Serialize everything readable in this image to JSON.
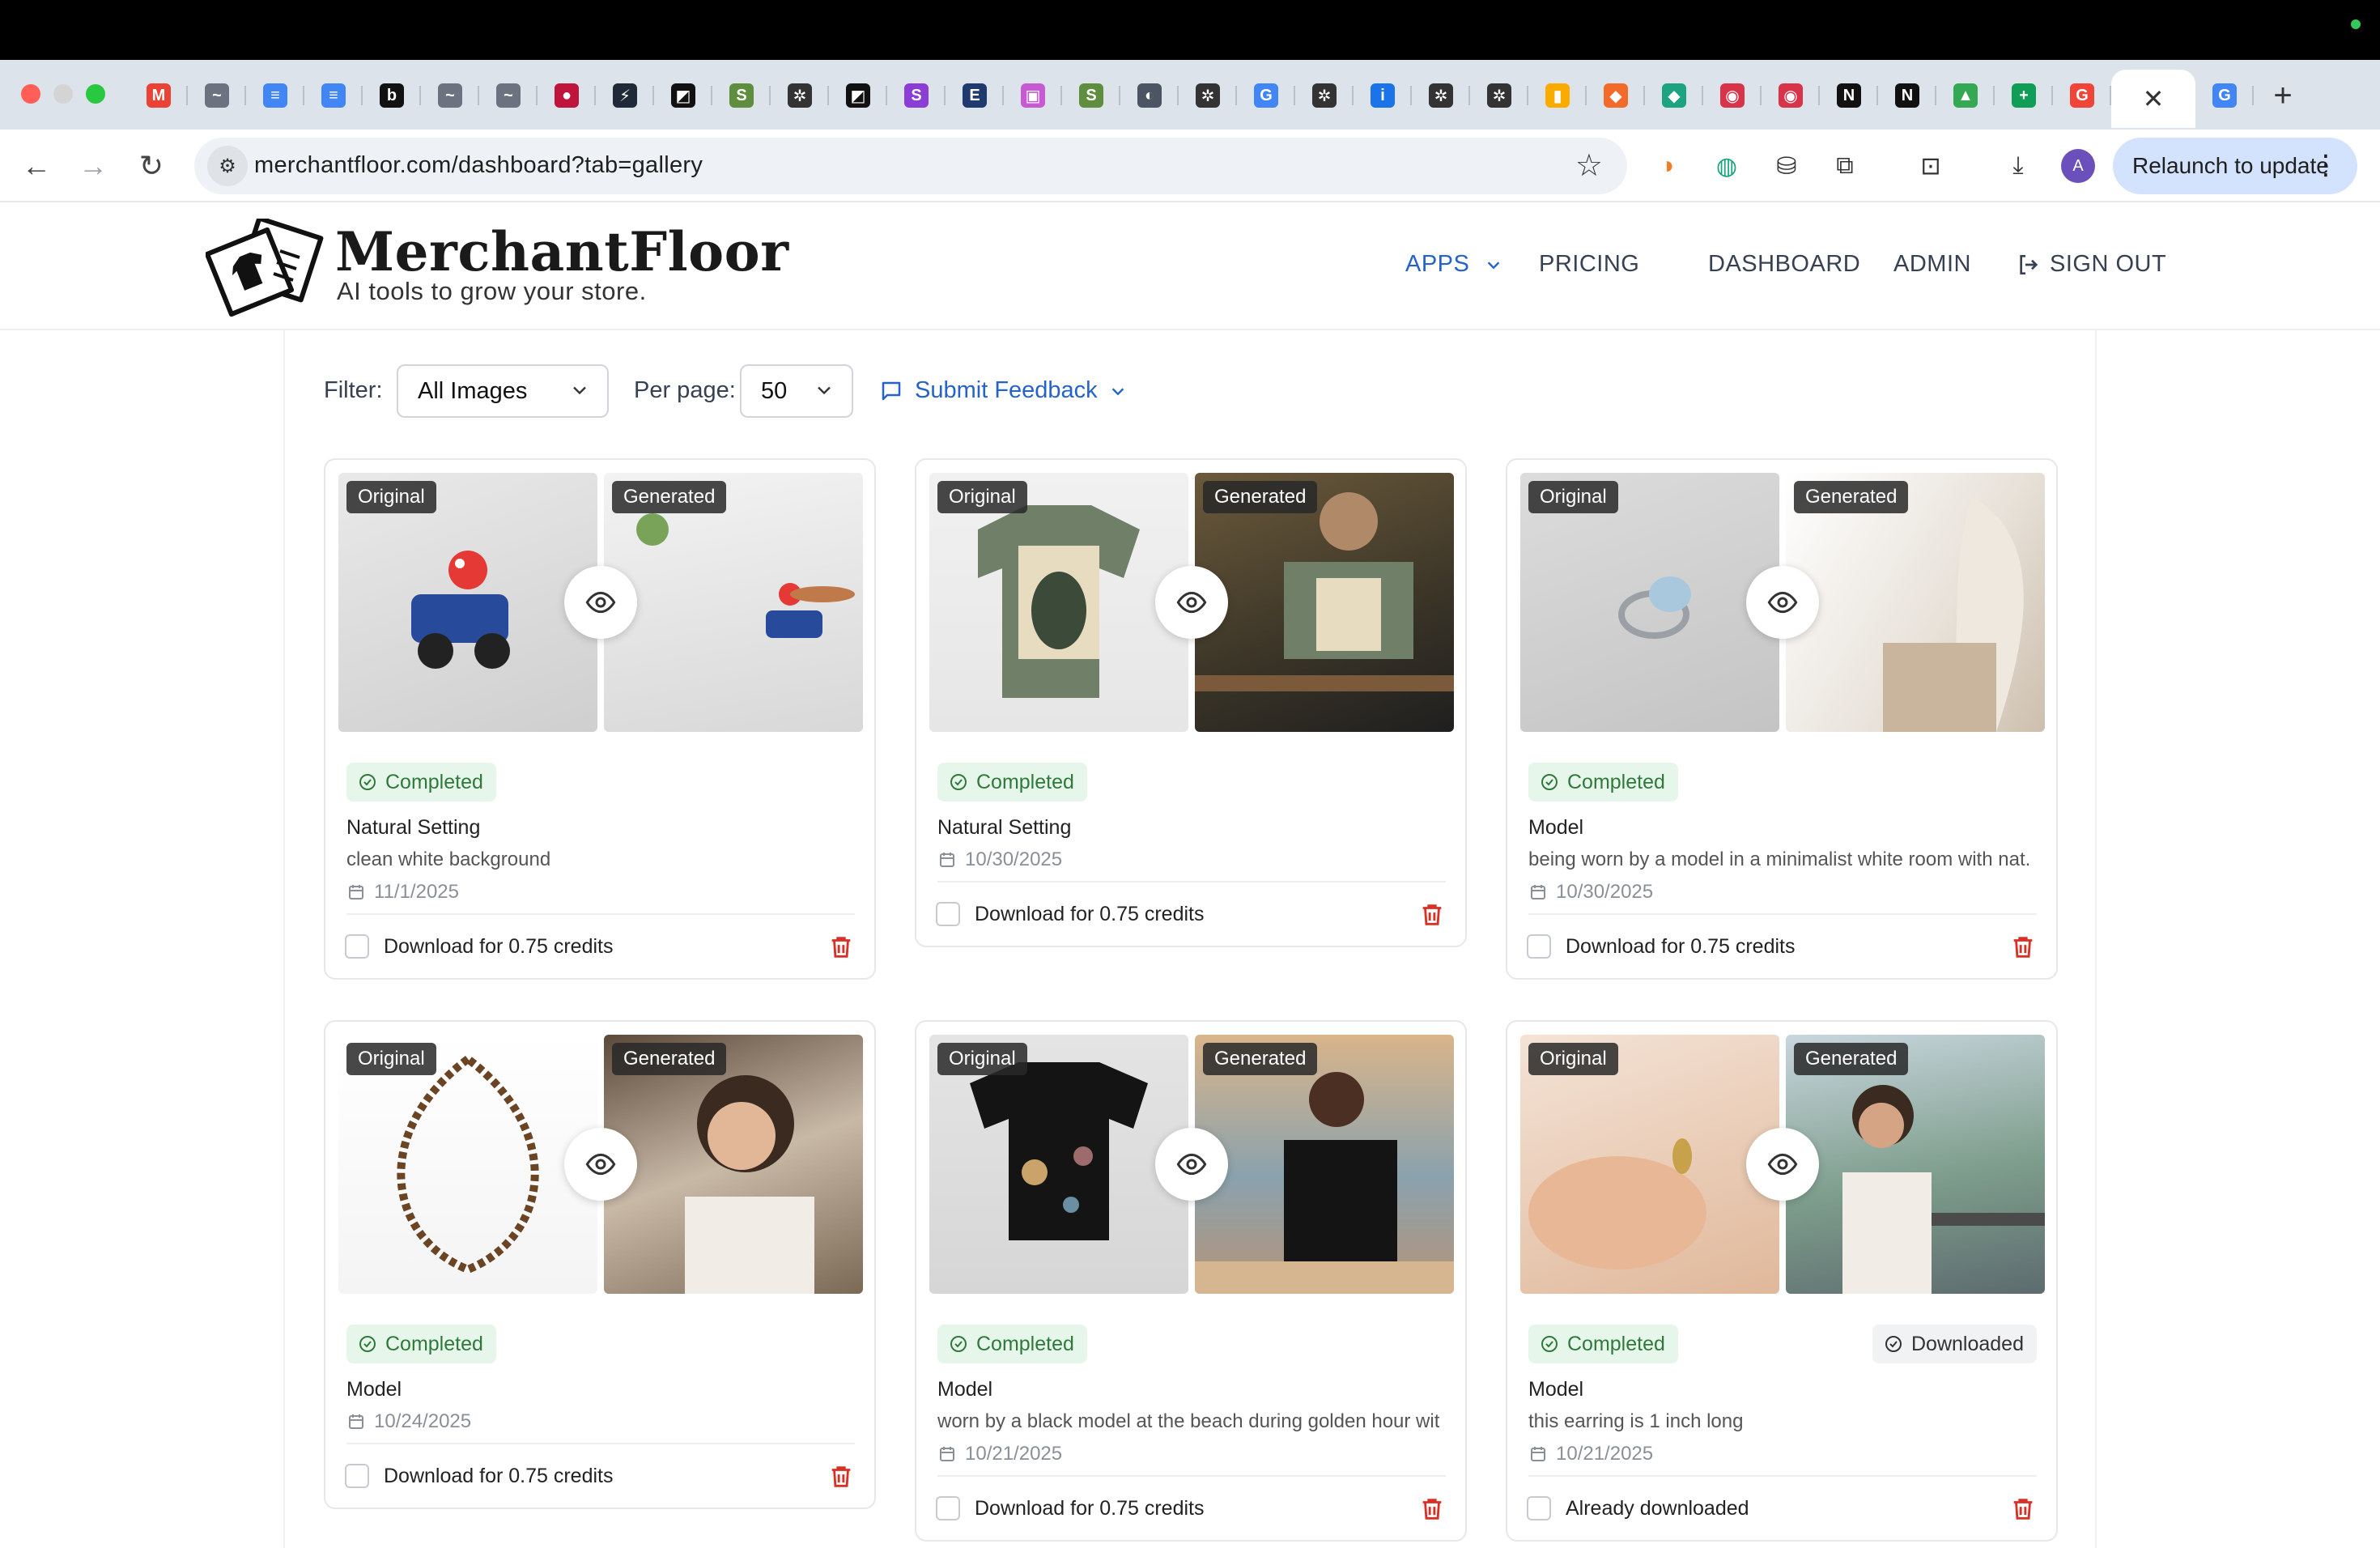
{
  "browser": {
    "url": "merchantfloor.com/dashboard?tab=gallery",
    "relaunch_label": "Relaunch to update",
    "profile_initial": "A",
    "active_tab_close": "✕",
    "new_tab": "+",
    "tab_favicons": [
      {
        "icon": "gmail-icon",
        "glyph": "M",
        "color": "#ea4335"
      },
      {
        "icon": "bird-icon",
        "glyph": "~",
        "color": "#6b7280"
      },
      {
        "icon": "docs-icon",
        "glyph": "≡",
        "color": "#4285f4"
      },
      {
        "icon": "docs-icon",
        "glyph": "≡",
        "color": "#4285f4"
      },
      {
        "icon": "b-icon",
        "glyph": "b",
        "color": "#111111"
      },
      {
        "icon": "bird-icon",
        "glyph": "~",
        "color": "#6b7280"
      },
      {
        "icon": "bird-icon",
        "glyph": "~",
        "color": "#6b7280"
      },
      {
        "icon": "lg-icon",
        "glyph": "●",
        "color": "#c0143c"
      },
      {
        "icon": "bolt-icon",
        "glyph": "⚡",
        "color": "#1f2937"
      },
      {
        "icon": "slash-icon",
        "glyph": "◩",
        "color": "#111111"
      },
      {
        "icon": "shopify-icon",
        "glyph": "S",
        "color": "#5e8e3e"
      },
      {
        "icon": "openai-icon",
        "glyph": "✲",
        "color": "#333333"
      },
      {
        "icon": "slash-icon",
        "glyph": "◩",
        "color": "#111111"
      },
      {
        "icon": "s-icon",
        "glyph": "S",
        "color": "#8b3dd6"
      },
      {
        "icon": "elf-icon",
        "glyph": "E",
        "color": "#1e3a6e"
      },
      {
        "icon": "image-icon",
        "glyph": "▣",
        "color": "#c65ad2"
      },
      {
        "icon": "shopify-icon",
        "glyph": "S",
        "color": "#5e8e3e"
      },
      {
        "icon": "globe-icon",
        "glyph": "◐",
        "color": "#4b5563"
      },
      {
        "icon": "openai-icon",
        "glyph": "✲",
        "color": "#333333"
      },
      {
        "icon": "google-icon",
        "glyph": "G",
        "color": "#4285f4"
      },
      {
        "icon": "openai-icon",
        "glyph": "✲",
        "color": "#333333"
      },
      {
        "icon": "info-icon",
        "glyph": "i",
        "color": "#1a73e8"
      },
      {
        "icon": "openai-icon",
        "glyph": "✲",
        "color": "#333333"
      },
      {
        "icon": "openai-icon",
        "glyph": "✲",
        "color": "#333333"
      },
      {
        "icon": "analytics-icon",
        "glyph": "▮",
        "color": "#f9ab00"
      },
      {
        "icon": "fox-icon",
        "glyph": "◆",
        "color": "#f26b2a"
      },
      {
        "icon": "diamond-icon",
        "glyph": "◆",
        "color": "#1ea382"
      },
      {
        "icon": "pocket-icon",
        "glyph": "◉",
        "color": "#d9334a"
      },
      {
        "icon": "pocket-icon",
        "glyph": "◉",
        "color": "#d9334a"
      },
      {
        "icon": "notion-icon",
        "glyph": "N",
        "color": "#111111"
      },
      {
        "icon": "notion-icon",
        "glyph": "N",
        "color": "#111111"
      },
      {
        "icon": "drive-icon",
        "glyph": "▲",
        "color": "#34a853"
      },
      {
        "icon": "sheets-icon",
        "glyph": "+",
        "color": "#0f9d58"
      },
      {
        "icon": "grammarly-icon",
        "glyph": "G",
        "color": "#f04438"
      }
    ],
    "last_tab_favicon": {
      "icon": "google-icon",
      "glyph": "G",
      "color": "#4285f4"
    }
  },
  "site": {
    "brand": "MerchantFloor",
    "tagline": "AI tools to grow your store.",
    "nav": {
      "apps": "APPS",
      "pricing": "PRICING",
      "dashboard": "DASHBOARD",
      "admin": "ADMIN",
      "sign_out": "SIGN OUT"
    },
    "accent_color": "#2563c9"
  },
  "controls": {
    "filter_label": "Filter:",
    "filter_value": "All Images",
    "per_page_label": "Per page:",
    "per_page_value": "50",
    "feedback_label": "Submit Feedback"
  },
  "labels": {
    "original": "Original",
    "generated": "Generated",
    "completed": "Completed",
    "downloaded": "Downloaded"
  },
  "cards": [
    {
      "style": "Natural Setting",
      "prompt": "clean white background",
      "date": "11/1/2025",
      "download": "Download for 0.75 credits",
      "downloaded": false
    },
    {
      "style": "Natural Setting",
      "prompt": "",
      "date": "10/30/2025",
      "download": "Download for 0.75 credits",
      "downloaded": false
    },
    {
      "style": "Model",
      "prompt": "being worn by a model in a minimalist white room with nat...",
      "date": "10/30/2025",
      "download": "Download for 0.75 credits",
      "downloaded": false
    },
    {
      "style": "Model",
      "prompt": "",
      "date": "10/24/2025",
      "download": "Download for 0.75 credits",
      "downloaded": false
    },
    {
      "style": "Model",
      "prompt": "worn by a black model at the beach during golden hour wit...",
      "date": "10/21/2025",
      "download": "Download for 0.75 credits",
      "downloaded": false
    },
    {
      "style": "Model",
      "prompt": "this earring is 1 inch long",
      "date": "10/21/2025",
      "download": "Already downloaded",
      "downloaded": true
    }
  ]
}
